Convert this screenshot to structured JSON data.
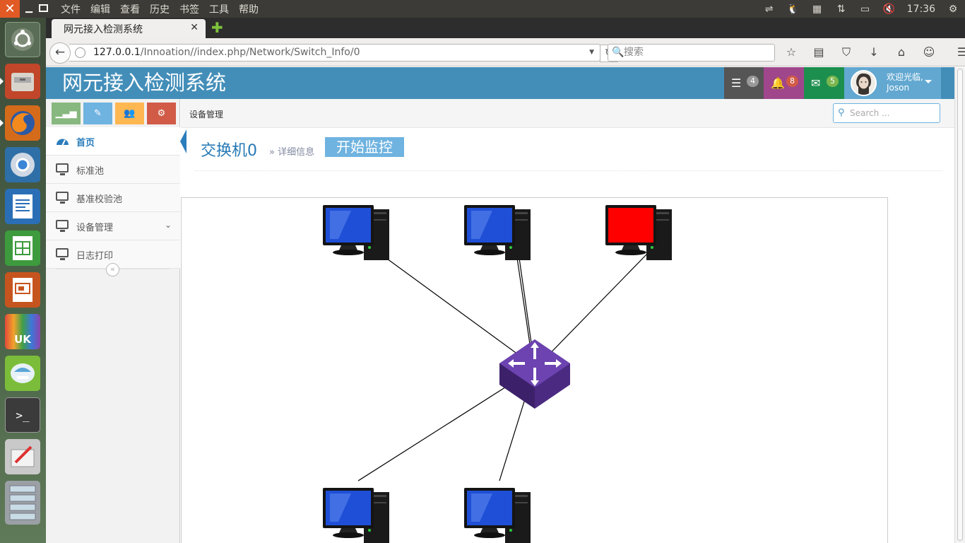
{
  "os": {
    "menus": [
      "文件",
      "编辑",
      "查看",
      "历史",
      "书签",
      "工具",
      "帮助"
    ],
    "clock": "17:36",
    "tray_icons": [
      "network-icon",
      "tux-icon",
      "calendar-icon",
      "transfer-icon",
      "battery-icon",
      "volume-icon",
      "clock-text",
      "power-gear-icon"
    ]
  },
  "launcher": {
    "apps": [
      "ubuntu-dash",
      "file-manager",
      "firefox",
      "chromium",
      "libreoffice-writer",
      "libreoffice-calc",
      "libreoffice-impress",
      "ubuntu-software",
      "app-installer",
      "terminal",
      "editor",
      "workspace-switcher"
    ]
  },
  "browser": {
    "tab_title": "网元接入检测系统",
    "url_host": "127.0.0.1",
    "url_path": "/Innoation//index.php/Network/Switch_Info/0",
    "search_placeholder": "搜索"
  },
  "app": {
    "title": "网元接入检测系统",
    "colors": {
      "header": "#438eb9",
      "tasks": "#555555",
      "notifications": "#a0478c",
      "messages": "#1c8f4e",
      "user": "#62a8d1"
    },
    "badges": {
      "tasks": "4",
      "notifications": "8",
      "messages": "5"
    },
    "user": {
      "greeting": "欢迎光临,",
      "name": "Joson"
    }
  },
  "sidebar": {
    "items": [
      {
        "label": "首页",
        "active": true
      },
      {
        "label": "标准池"
      },
      {
        "label": "基准校验池"
      },
      {
        "label": "设备管理",
        "has_submenu": true
      },
      {
        "label": "日志打印"
      }
    ]
  },
  "breadcrumb": {
    "current": "设备管理"
  },
  "search": {
    "placeholder": "Search ..."
  },
  "page": {
    "title": "交换机",
    "title_id": "0",
    "subtitle": "» 详细信息",
    "monitor_button": "开始监控"
  },
  "topology": {
    "hub": "switch-icon",
    "nodes": [
      {
        "name": "pc-top-left",
        "status": "normal",
        "screen_color": "#1e4fd6"
      },
      {
        "name": "pc-top-center",
        "status": "normal",
        "screen_color": "#1e4fd6"
      },
      {
        "name": "pc-top-right",
        "status": "alert",
        "screen_color": "#ff0000"
      },
      {
        "name": "pc-bottom-left",
        "status": "normal",
        "screen_color": "#1e4fd6"
      },
      {
        "name": "pc-bottom-center",
        "status": "normal",
        "screen_color": "#1e4fd6"
      }
    ]
  }
}
